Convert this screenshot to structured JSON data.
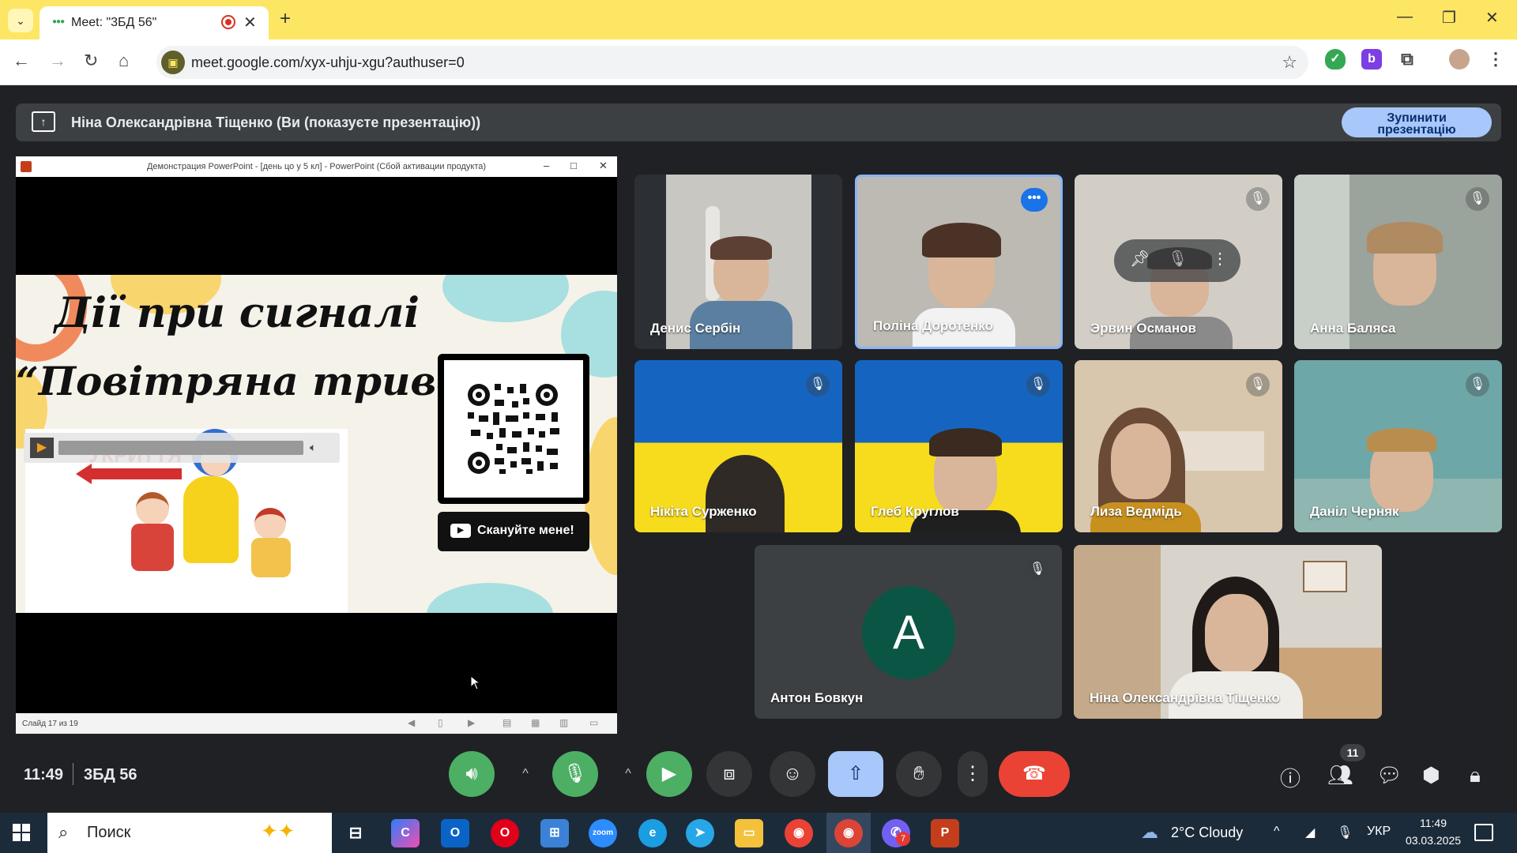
{
  "browser": {
    "tab_title": "Meet: \"3БД 56\"",
    "url": "meet.google.com/xyx-uhju-xgu?authuser=0"
  },
  "banner": {
    "text": "Ніна Олександрівна Тіщенко (Ви (показуєте презентацію))",
    "stop_line1": "Зупинити",
    "stop_line2": "презентацію"
  },
  "presentation": {
    "window_title": "Демонстрация PowerPoint - [день цо у 5 кл] - PowerPoint (Сбой активации продукта)",
    "slide_title_line1": "Дії при сигналі",
    "slide_title_line2": "“Повітряна тривога”",
    "shelter_label": "УКРИТТЯ",
    "scan_button": "Скануйте мене!",
    "slide_counter": "Слайд 17 из 19"
  },
  "participants": [
    {
      "name": "Денис Сербін"
    },
    {
      "name": "Поліна Доротенко"
    },
    {
      "name": "Эрвин Османов"
    },
    {
      "name": "Анна Баляса"
    },
    {
      "name": "Нікіта Сурженко"
    },
    {
      "name": "Глеб Круглов"
    },
    {
      "name": "Лиза Ведмідь"
    },
    {
      "name": "Даніл Черняк"
    },
    {
      "name": "Антон Бовкун",
      "avatar_letter": "A"
    },
    {
      "name": "Ніна Олександрівна Тіщенко"
    }
  ],
  "meeting": {
    "time": "11:49",
    "code": "3БД 56",
    "participant_count": "11"
  },
  "taskbar": {
    "search_placeholder": "Поиск",
    "weather": "2°C  Cloudy",
    "language": "УКР",
    "time": "11:49",
    "date": "03.03.2025",
    "viber_badge": "7"
  },
  "colors": {
    "chrome_yellow": "#fde663",
    "meet_bg": "#202124",
    "mic_green": "#4caf64",
    "end_call_red": "#ea4335",
    "present_blue": "#a8c7fa"
  }
}
